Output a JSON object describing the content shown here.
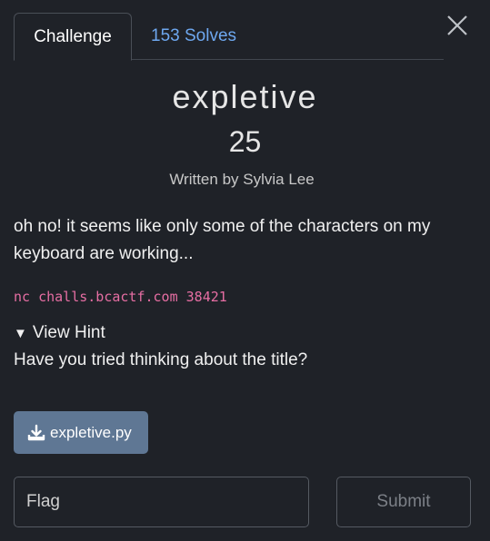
{
  "tabs": [
    {
      "label": "Challenge",
      "active": true
    },
    {
      "label": "153 Solves",
      "active": false
    }
  ],
  "challenge": {
    "title": "expletive",
    "points": "25",
    "author": "Written by Sylvia Lee",
    "description": "oh no! it seems like only some of the characters on my keyboard are working...",
    "command": "nc challs.bcactf.com 38421",
    "hint_toggle_label": "View Hint",
    "hint_text": "Have you tried thinking about the title?",
    "file_label": "expletive.py"
  },
  "form": {
    "flag_placeholder": "Flag",
    "submit_label": "Submit"
  },
  "icons": {
    "close": "close-icon",
    "hint_toggle": "triangle-down-icon",
    "file": "download-icon"
  },
  "colors": {
    "background": "#1f2228",
    "link": "#6ea8f0",
    "command": "#e66ea3",
    "file_button": "#5f7794"
  }
}
